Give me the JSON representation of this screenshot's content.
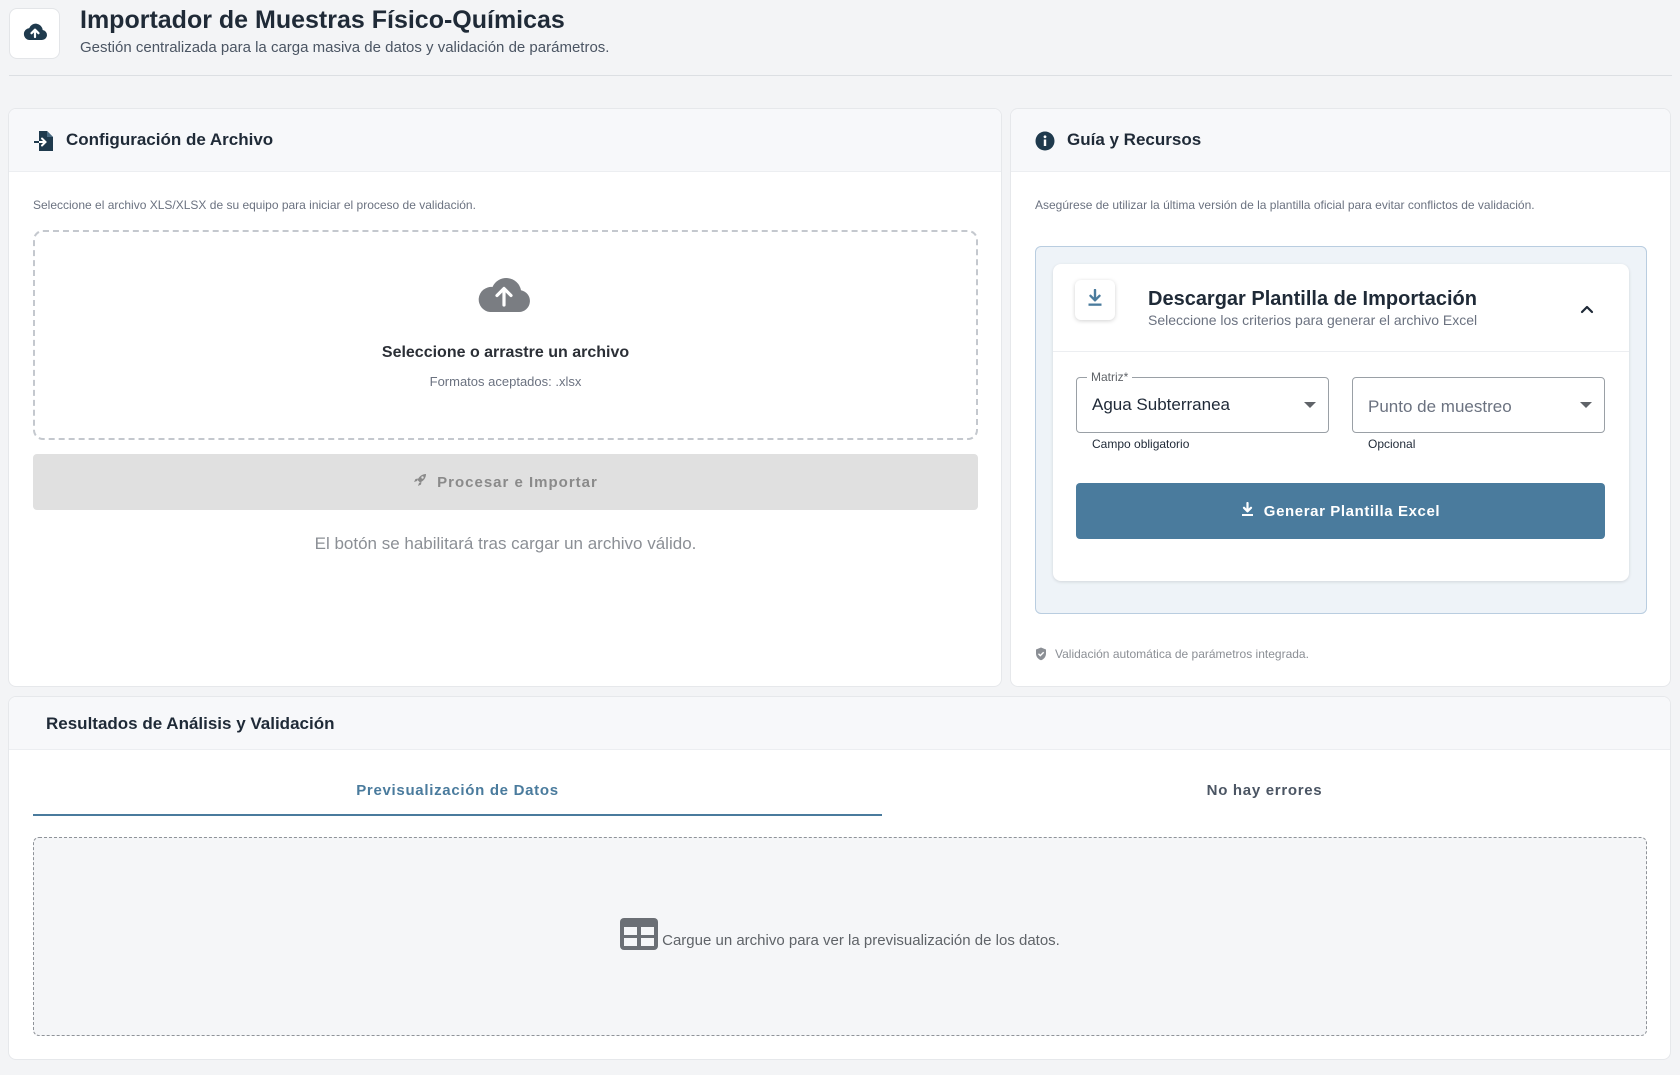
{
  "header": {
    "title": "Importador de Muestras Físico-Químicas",
    "subtitle": "Gestión centralizada para la carga masiva de datos y validación de parámetros.",
    "icon": "cloud-upload-icon"
  },
  "config": {
    "title": "Configuración de Archivo",
    "description": "Seleccione el archivo XLS/XLSX de su equipo para iniciar el proceso de validación.",
    "dropzone": {
      "title": "Seleccione o arrastre un archivo",
      "formats": "Formatos aceptados: .xlsx"
    },
    "process_button": "Procesar e Importar",
    "hint": "El botón se habilitará tras cargar un archivo válido."
  },
  "guide": {
    "title": "Guía y Recursos",
    "description": "Asegúrese de utilizar la última versión de la plantilla oficial para evitar conflictos de validación.",
    "template": {
      "title": "Descargar Plantilla de Importación",
      "subtitle": "Seleccione los criterios para generar el archivo Excel",
      "matrix_label": "Matriz*",
      "matrix_value": "Agua Subterranea",
      "matrix_helper": "Campo obligatorio",
      "point_placeholder": "Punto de muestreo",
      "point_helper": "Opcional",
      "generate_button": "Generar Plantilla Excel"
    },
    "footer_note": "Validación automática de parámetros integrada."
  },
  "results": {
    "title": "Resultados de Análisis y Validación",
    "tabs": [
      {
        "label": "Previsualización de Datos",
        "active": true
      },
      {
        "label": "No hay errores",
        "active": false
      }
    ],
    "empty_text": "Cargue un archivo para ver la previsualización de los datos."
  },
  "colors": {
    "accent": "#4a7b9d",
    "background": "#f3f4f6",
    "disabled_button": "#e0e0e0"
  }
}
